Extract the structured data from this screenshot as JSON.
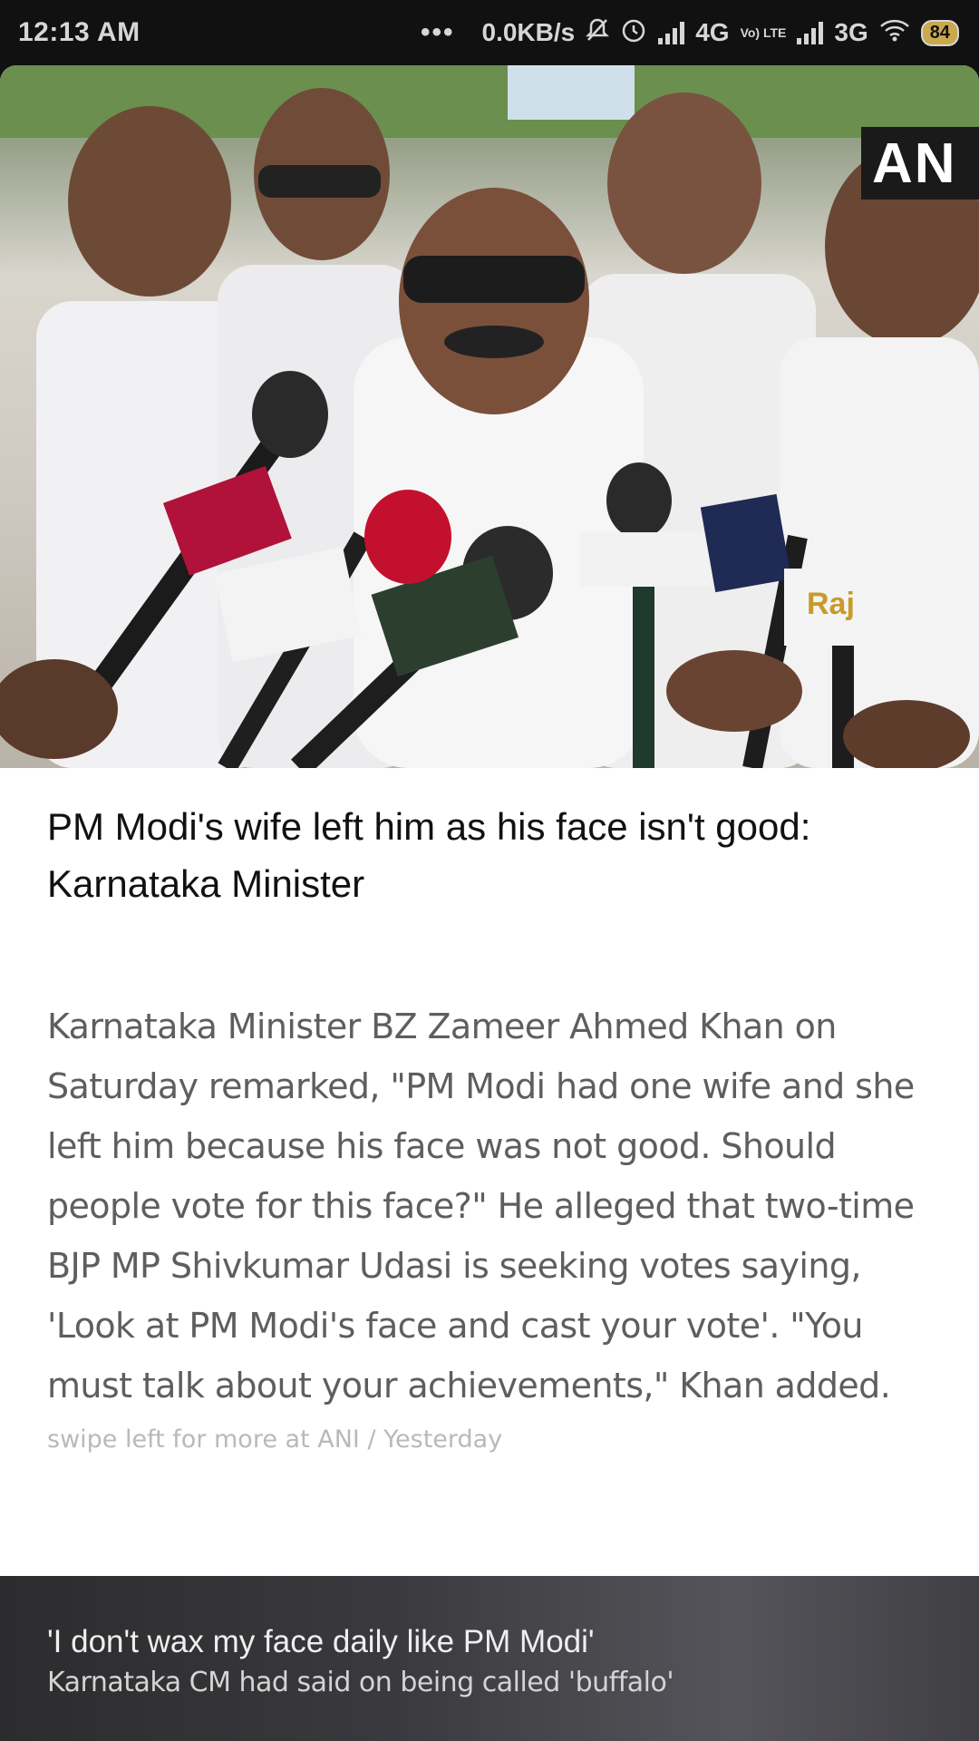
{
  "status_bar": {
    "time": "12:13 AM",
    "dots": "•••",
    "network_speed": "0.0KB/s",
    "network_1": "4G",
    "volte": "Vo) LTE",
    "network_2": "3G",
    "battery": "84"
  },
  "article": {
    "image_logo": "AN",
    "headline": "PM Modi's wife left him as his face isn't good: Karnataka Minister",
    "summary": "Karnataka Minister BZ Zameer Ahmed Khan on Saturday remarked, \"PM Modi had one wife and she left him because his face was not good. Should people vote for this face?\" He alleged that two-time BJP MP Shivkumar Udasi is seeking votes saying, 'Look at PM Modi's face and cast your vote'. \"You must talk about your achievements,\" Khan added.",
    "meta": "swipe left for more at ANI / Yesterday"
  },
  "footer": {
    "title": "'I don't wax my face daily like PM Modi'",
    "subtitle": "Karnataka CM had said on being called 'buffalo'"
  },
  "colors": {
    "status_bg": "#111111",
    "card_bg": "#ffffff",
    "headline": "#111111",
    "summary": "#5e5e5e",
    "meta": "#b9b9b9"
  }
}
